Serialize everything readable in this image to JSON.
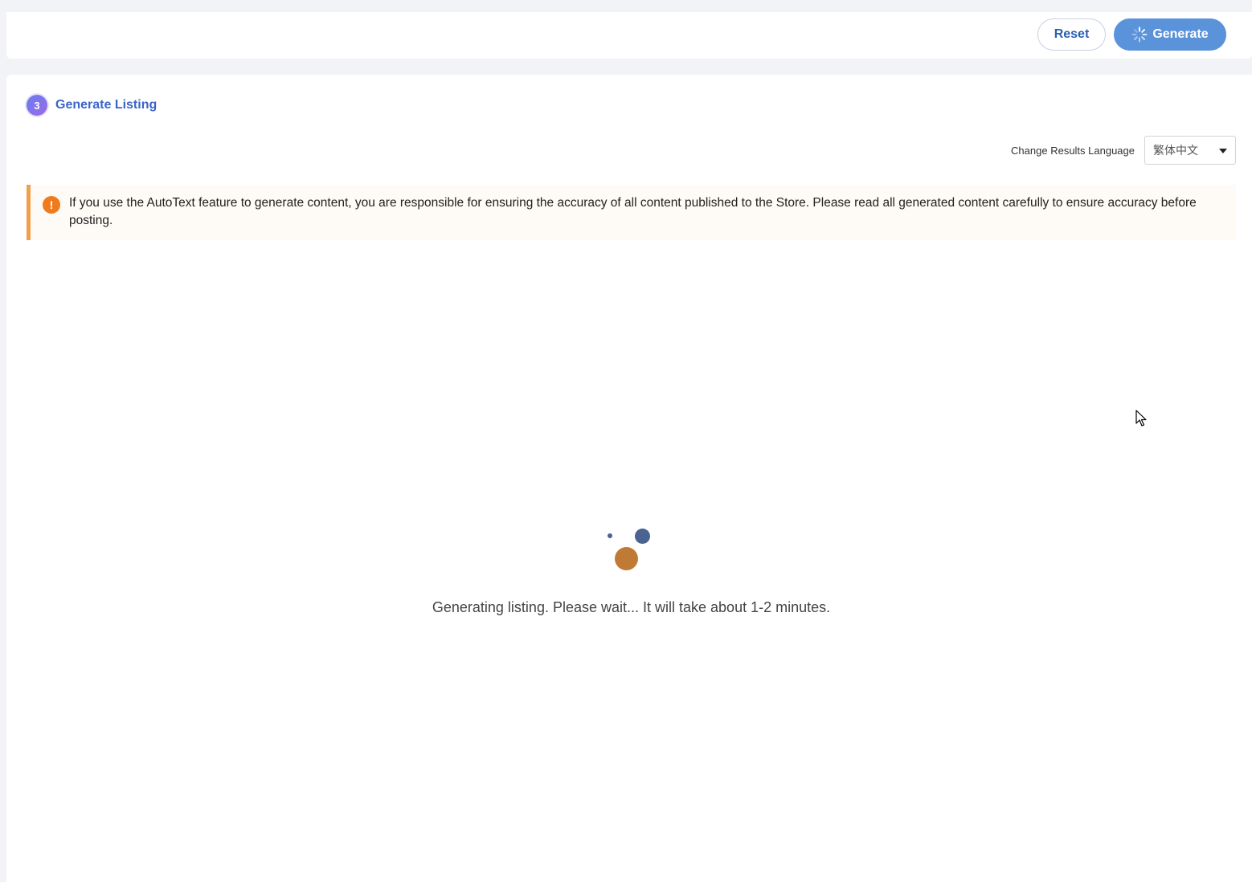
{
  "actions": {
    "reset_label": "Reset",
    "generate_label": "Generate"
  },
  "step": {
    "number": "3",
    "title": "Generate Listing"
  },
  "language": {
    "label": "Change Results Language",
    "selected": "繁体中文"
  },
  "warning": {
    "text": "If you use the AutoText feature to generate content, you are responsible for ensuring the accuracy of all content published to the Store. Please read all generated content carefully to ensure accuracy before posting."
  },
  "loading": {
    "text": "Generating listing. Please wait... It will take about 1-2 minutes."
  },
  "colors": {
    "primary": "#5b93db",
    "link": "#3a64c8",
    "warning_accent": "#f0a04b",
    "warning_icon": "#f07b1c",
    "loader_blue": "#4a6391",
    "loader_orange": "#bf7b36"
  },
  "icons": {
    "generate": "spinner-icon",
    "warning": "exclamation-circle-icon",
    "dropdown": "caret-down-icon"
  }
}
